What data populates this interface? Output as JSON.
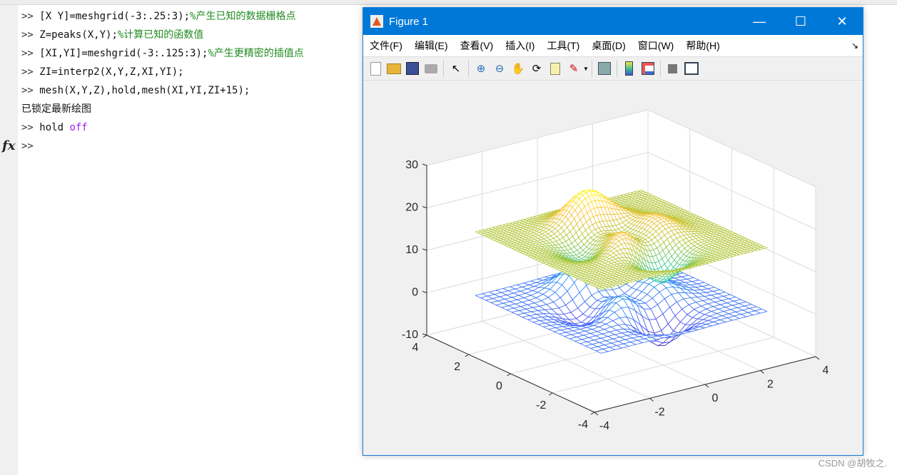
{
  "command_window": {
    "lines": [
      {
        "prompt": ">>",
        "code": "[X Y]=meshgrid(-3:.25:3);",
        "comment": "%产生已知的数据栅格点"
      },
      {
        "prompt": ">>",
        "code": "Z=peaks(X,Y);",
        "comment": "%计算已知的函数值"
      },
      {
        "prompt": ">>",
        "code": "[XI,YI]=meshgrid(-3:.125:3);",
        "comment": "%产生更精密的插值点"
      },
      {
        "prompt": ">>",
        "code": "ZI=interp2(X,Y,Z,XI,YI);",
        "comment": ""
      },
      {
        "prompt": ">>",
        "code": "mesh(X,Y,Z),hold,mesh(XI,YI,ZI+15);",
        "comment": ""
      }
    ],
    "message": "已锁定最新绘图",
    "hold_cmd": "hold",
    "hold_arg": "off",
    "prompt": ">>",
    "fx_label": "fx"
  },
  "figure": {
    "title": "Figure 1",
    "menu": [
      "文件(F)",
      "编辑(E)",
      "查看(V)",
      "插入(I)",
      "工具(T)",
      "桌面(D)",
      "窗口(W)",
      "帮助(H)"
    ],
    "toolbar_icons": [
      "new-file-icon",
      "open-folder-icon",
      "save-icon",
      "print-icon",
      "pointer-icon",
      "zoom-in-icon",
      "zoom-out-icon",
      "pan-hand-icon",
      "rotate-3d-icon",
      "data-cursor-icon",
      "brush-icon",
      "link-plot-icon",
      "colorbar-icon",
      "legend-icon",
      "hide-plot-tools-icon",
      "show-plot-tools-icon"
    ]
  },
  "chart_data": {
    "type": "mesh3d",
    "function": "peaks",
    "series": [
      {
        "grid": [
          -3,
          0.25,
          3
        ],
        "z_offset": 0,
        "colormap": "parula"
      },
      {
        "grid": [
          -3,
          0.125,
          3
        ],
        "z_offset": 15,
        "colormap": "parula"
      }
    ],
    "xlim": [
      -4,
      4
    ],
    "ylim": [
      -4,
      4
    ],
    "zlim": [
      -10,
      30
    ],
    "xticks": [
      "-4",
      "-2",
      "0",
      "2",
      "4"
    ],
    "yticks": [
      "-4",
      "-2",
      "0",
      "2",
      "4"
    ],
    "zticks": [
      "-10",
      "0",
      "10",
      "20",
      "30"
    ],
    "grid": true,
    "view": [
      -37.5,
      30
    ]
  },
  "watermark": "CSDN @胡牧之."
}
